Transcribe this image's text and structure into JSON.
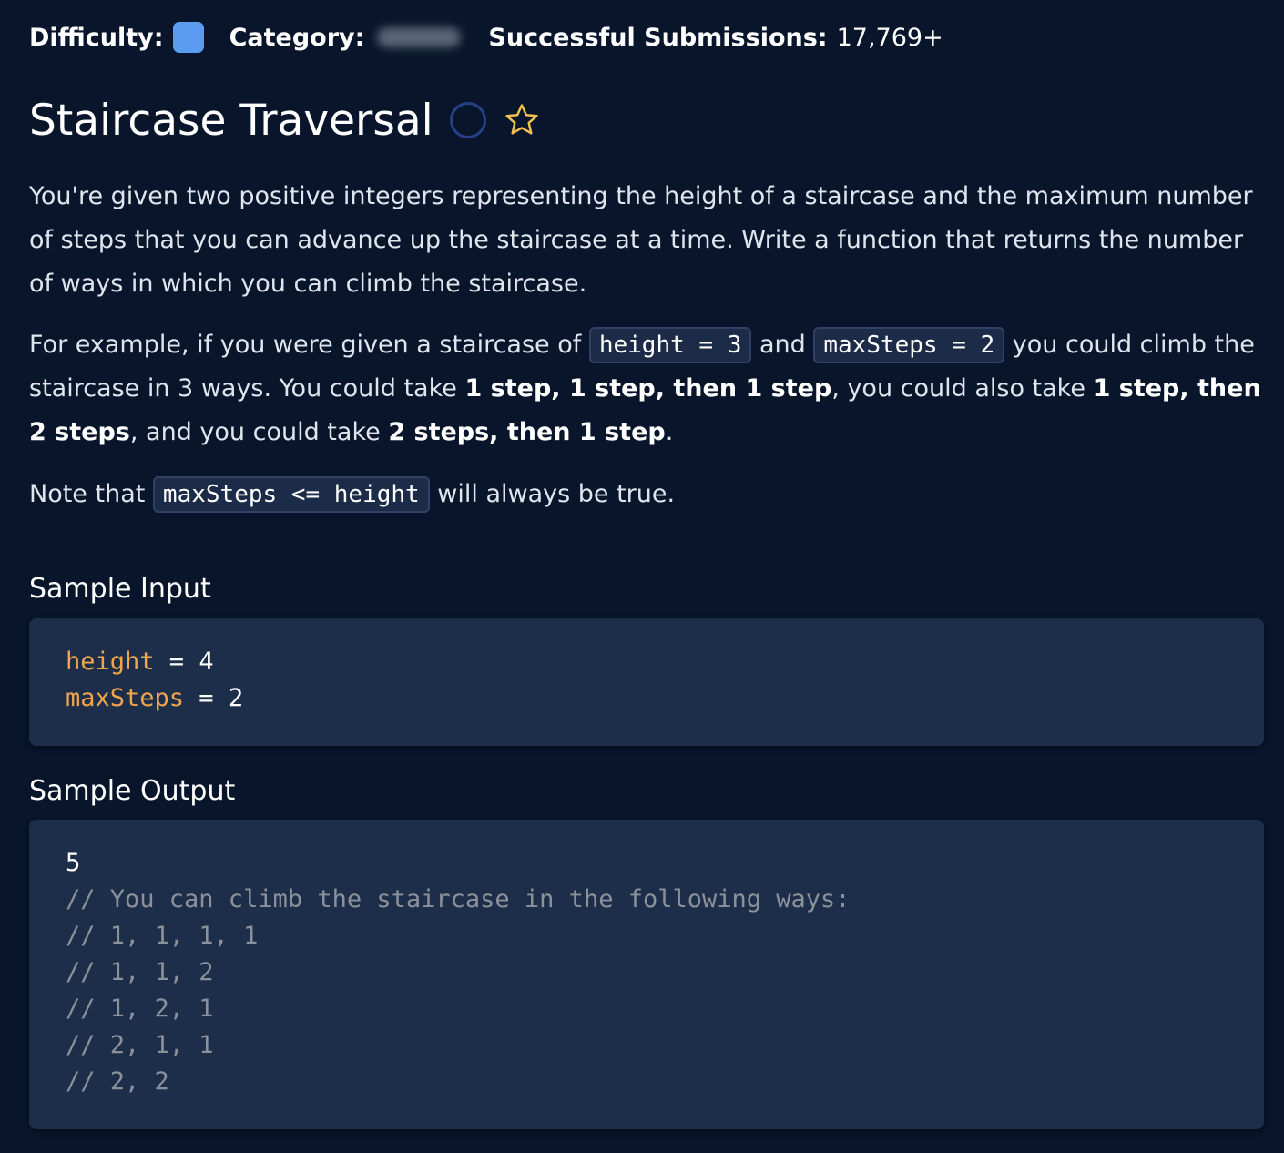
{
  "meta": {
    "difficulty_label": "Difficulty:",
    "difficulty_color": "#5b9cf0",
    "category_label": "Category:",
    "submissions_label": "Successful Submissions:",
    "submissions_value": "17,769+"
  },
  "title": "Staircase Traversal",
  "icons": {
    "status": "circle-icon",
    "favorite": "star-icon",
    "star_color": "#f2c14e"
  },
  "description": {
    "p1": "You're given two positive integers representing the height of a staircase and the maximum number of steps that you can advance up the staircase at a time. Write a function that returns the number of ways in which you can climb the staircase.",
    "p2_a": "For example, if you were given a staircase of ",
    "p2_code1": "height = 3",
    "p2_b": " and ",
    "p2_code2": "maxSteps = 2",
    "p2_c": " you could climb the staircase in 3 ways. You could take ",
    "p2_bold1": "1 step, 1 step, then 1 step",
    "p2_d": ", you could also take ",
    "p2_bold2": "1 step, then 2 steps",
    "p2_e": ", and you could take ",
    "p2_bold3": "2 steps, then 1 step",
    "p2_f": ".",
    "p3_a": "Note that ",
    "p3_code": "maxSteps <= height",
    "p3_b": " will always be true."
  },
  "sample_input": {
    "heading": "Sample Input",
    "lines": [
      {
        "var": "height",
        "op": " = ",
        "val": "4"
      },
      {
        "var": "maxSteps",
        "op": " = ",
        "val": "2"
      }
    ]
  },
  "sample_output": {
    "heading": "Sample Output",
    "value": "5",
    "comments": [
      "// You can climb the staircase in the following ways:",
      "// 1, 1, 1, 1",
      "// 1, 1, 2",
      "// 1, 2, 1",
      "// 2, 1, 1",
      "// 2, 2"
    ]
  }
}
